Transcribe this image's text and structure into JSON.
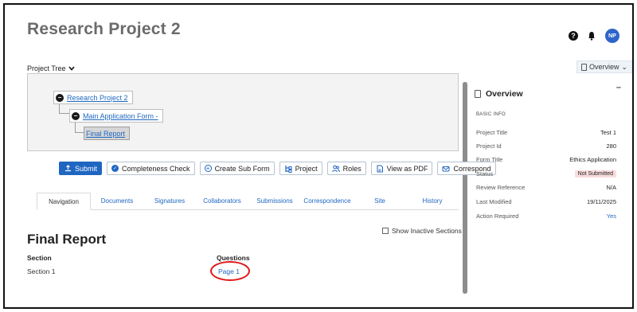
{
  "header": {
    "title": "Research Project 2",
    "help_label": "?",
    "avatar_initials": "NP"
  },
  "overview_tab": {
    "label": "Overview",
    "arrow": "⌄"
  },
  "project_tree": {
    "label": "Project Tree",
    "nodes": [
      {
        "label": "Research Project 2"
      },
      {
        "label": "Main Application Form -"
      },
      {
        "label": "Final Report"
      }
    ]
  },
  "actions": {
    "submit": "Submit",
    "completeness": "Completeness Check",
    "create_sub_form": "Create Sub Form",
    "project": "Project",
    "roles": "Roles",
    "view_pdf": "View as PDF",
    "correspond": "Correspond"
  },
  "tabs": [
    {
      "label": "Navigation",
      "active": true
    },
    {
      "label": "Documents"
    },
    {
      "label": "Signatures"
    },
    {
      "label": "Collaborators"
    },
    {
      "label": "Submissions"
    },
    {
      "label": "Correspondence"
    },
    {
      "label": "Site"
    },
    {
      "label": "History"
    }
  ],
  "main": {
    "section_title": "Final Report",
    "show_inactive_label": "Show Inactive Sections",
    "columns": {
      "section": "Section",
      "questions": "Questions"
    },
    "rows": [
      {
        "section": "Section 1",
        "questions": "Page 1"
      }
    ]
  },
  "sidebar": {
    "title": "Overview",
    "collapse": "–",
    "basic_info": "BASIC INFO",
    "rows": [
      {
        "label": "Project Title",
        "value": "Test 1"
      },
      {
        "label": "Project Id",
        "value": "280"
      },
      {
        "label": "Form Title",
        "value": "Ethics Application"
      },
      {
        "label": "Status",
        "value": "Not Submitted"
      },
      {
        "label": "Review Reference",
        "value": "N/A"
      },
      {
        "label": "Last Modified",
        "value": "19/11/2025"
      },
      {
        "label": "Action Required",
        "value": "Yes"
      }
    ]
  },
  "colors": {
    "primary": "#1f66c1",
    "status_badge_bg": "#f8dcdc",
    "status_badge_text": "#b03a3a",
    "highlight": "#e0191b"
  }
}
